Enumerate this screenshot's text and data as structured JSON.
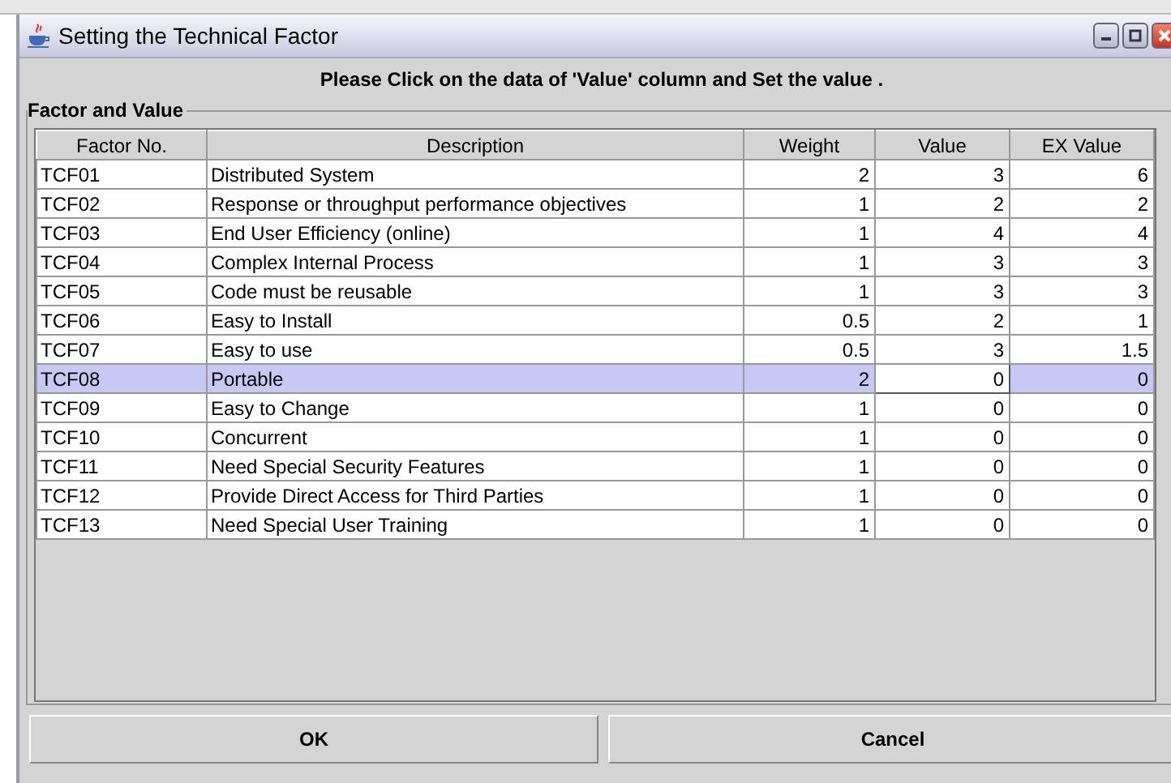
{
  "window": {
    "title": "Setting the Technical Factor"
  },
  "instruction": "Please Click on the data of 'Value' column and Set the value .",
  "group": {
    "title": "Factor and Value"
  },
  "table": {
    "columns": [
      "Factor No.",
      "Description",
      "Weight",
      "Value",
      "EX Value"
    ],
    "rows": [
      {
        "cells": [
          "TCF01",
          "Distributed System",
          "2",
          "3",
          "6"
        ],
        "selected": false
      },
      {
        "cells": [
          "TCF02",
          "Response or throughput performance objectives",
          "1",
          "2",
          "2"
        ],
        "selected": false
      },
      {
        "cells": [
          "TCF03",
          "End User Efficiency (online)",
          "1",
          "4",
          "4"
        ],
        "selected": false
      },
      {
        "cells": [
          "TCF04",
          "Complex Internal Process",
          "1",
          "3",
          "3"
        ],
        "selected": false
      },
      {
        "cells": [
          "TCF05",
          "Code must be reusable",
          "1",
          "3",
          "3"
        ],
        "selected": false
      },
      {
        "cells": [
          "TCF06",
          "Easy to Install",
          "0.5",
          "2",
          "1"
        ],
        "selected": false
      },
      {
        "cells": [
          "TCF07",
          "Easy to use",
          "0.5",
          "3",
          "1.5"
        ],
        "selected": false
      },
      {
        "cells": [
          "TCF08",
          "Portable",
          "2",
          "0",
          "0"
        ],
        "selected": true
      },
      {
        "cells": [
          "TCF09",
          "Easy to Change",
          "1",
          "0",
          "0"
        ],
        "selected": false
      },
      {
        "cells": [
          "TCF10",
          "Concurrent",
          "1",
          "0",
          "0"
        ],
        "selected": false
      },
      {
        "cells": [
          "TCF11",
          "Need Special Security Features",
          "1",
          "0",
          "0"
        ],
        "selected": false
      },
      {
        "cells": [
          "TCF12",
          "Provide Direct Access for Third Parties",
          "1",
          "0",
          "0"
        ],
        "selected": false
      },
      {
        "cells": [
          "TCF13",
          "Need Special User Training",
          "1",
          "0",
          "0"
        ],
        "selected": false
      }
    ]
  },
  "buttons": [
    "OK",
    "Cancel"
  ]
}
